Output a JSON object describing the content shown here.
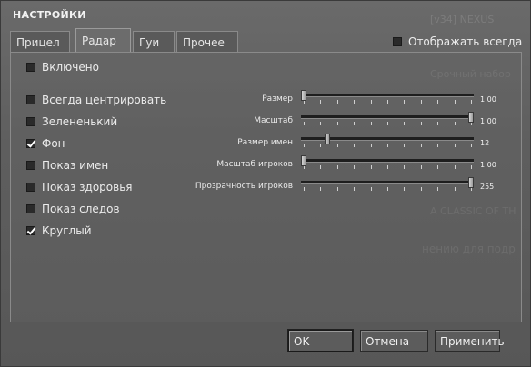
{
  "window": {
    "title": "НАСТРОЙКИ"
  },
  "background_text": [
    "[v34] NEXUS",
    "Срочный набор",
    "A CLASSIC OF TH",
    "нению для подр"
  ],
  "tabs": [
    {
      "label": "Прицел",
      "active": false
    },
    {
      "label": "Радар",
      "active": true
    },
    {
      "label": "Гуи",
      "active": false
    },
    {
      "label": "Прочее",
      "active": false
    }
  ],
  "show_always": {
    "label": "Отображать всегда",
    "checked": false
  },
  "options": {
    "enabled": {
      "label": "Включено",
      "checked": false
    },
    "items": [
      {
        "label": "Всегда центрировать",
        "checked": false
      },
      {
        "label": "Зелененький",
        "checked": false
      },
      {
        "label": "Фон",
        "checked": true
      },
      {
        "label": "Показ имен",
        "checked": false
      },
      {
        "label": "Показ здоровья",
        "checked": false
      },
      {
        "label": "Показ следов",
        "checked": false
      },
      {
        "label": "Круглый",
        "checked": true
      }
    ]
  },
  "sliders": [
    {
      "label": "Размер",
      "value": "1.00",
      "fraction": 0.0
    },
    {
      "label": "Масштаб",
      "value": "1.00",
      "fraction": 1.0
    },
    {
      "label": "Размер имен",
      "value": "12",
      "fraction": 0.14
    },
    {
      "label": "Масштаб игроков",
      "value": "1.00",
      "fraction": 0.0
    },
    {
      "label": "Прозрачность игроков",
      "value": "255",
      "fraction": 1.0
    }
  ],
  "buttons": {
    "ok": "OK",
    "cancel": "Отмена",
    "apply": "Применить"
  }
}
